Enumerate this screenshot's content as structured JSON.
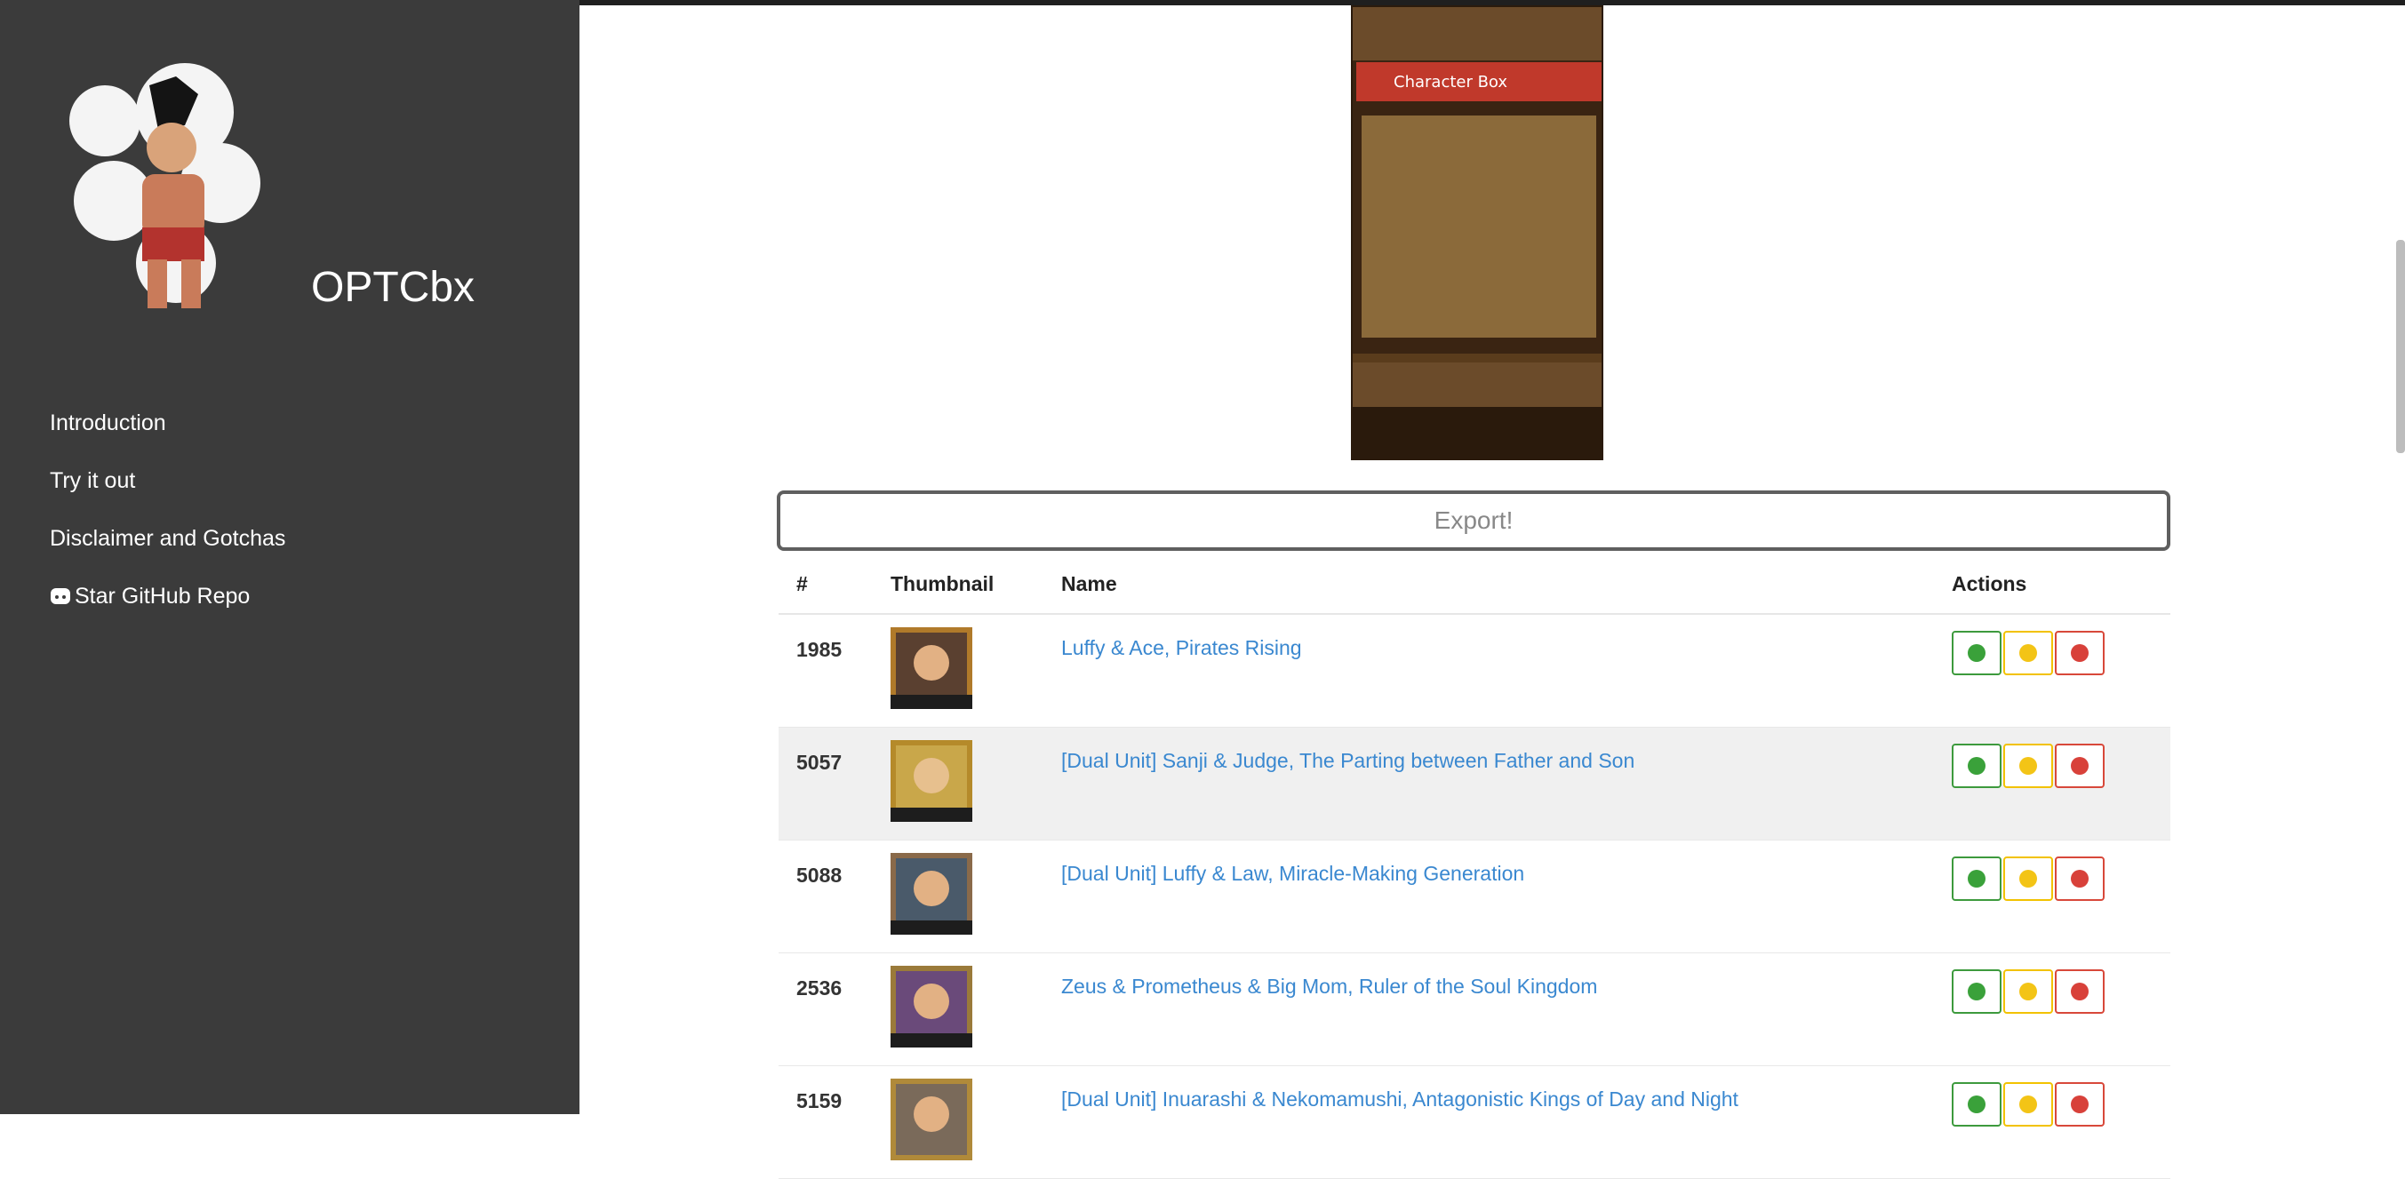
{
  "brand": {
    "name": "OPTCbx"
  },
  "nav": [
    {
      "label": "Introduction"
    },
    {
      "label": "Try it out"
    },
    {
      "label": "Disclaimer and Gotchas"
    },
    {
      "label": "Star GitHub Repo",
      "icon": "github-icon"
    }
  ],
  "preview": {
    "title": "Character Box"
  },
  "export": {
    "label": "Export!"
  },
  "table": {
    "headers": {
      "num": "#",
      "thumbnail": "Thumbnail",
      "name": "Name",
      "actions": "Actions"
    },
    "rows": [
      {
        "id": "1985",
        "name": "Luffy & Ace, Pirates Rising"
      },
      {
        "id": "5057",
        "name": "[Dual Unit] Sanji & Judge, The Parting between Father and Son"
      },
      {
        "id": "5088",
        "name": "[Dual Unit] Luffy & Law, Miracle-Making Generation"
      },
      {
        "id": "2536",
        "name": "Zeus & Prometheus & Big Mom, Ruler of the Soul Kingdom"
      },
      {
        "id": "5159",
        "name": "[Dual Unit] Inuarashi & Nekomamushi, Antagonistic Kings of Day and Night"
      }
    ]
  },
  "colors": {
    "sidebar": "#3b3b3b",
    "link": "#3a88d0",
    "good": "#3aa13a",
    "neutral": "#f3c416",
    "bad": "#d8413a"
  }
}
